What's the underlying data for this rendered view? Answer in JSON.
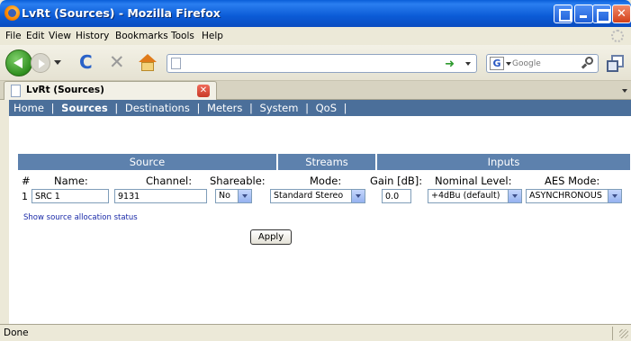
{
  "window": {
    "title": "LvRt (Sources) - Mozilla Firefox"
  },
  "menu": [
    "File",
    "Edit",
    "View",
    "History",
    "Bookmarks",
    "Tools",
    "Help"
  ],
  "toolbar": {
    "url": "",
    "search_placeholder": "Google"
  },
  "tab": {
    "label": "LvRt (Sources)"
  },
  "app_nav": {
    "items": [
      "Home",
      "Sources",
      "Destinations",
      "Meters",
      "System",
      "QoS"
    ],
    "active": "Sources"
  },
  "table": {
    "groups": [
      "Source",
      "Streams",
      "Inputs"
    ],
    "headers": {
      "num": "#",
      "name": "Name:",
      "channel": "Channel:",
      "shareable": "Shareable:",
      "mode": "Mode:",
      "gain": "Gain [dB]:",
      "nominal_level": "Nominal Level:",
      "aes_mode": "AES Mode:"
    },
    "rows": [
      {
        "num": "1",
        "name": "SRC 1",
        "channel": "9131",
        "shareable": "No",
        "mode": "Standard Stereo",
        "gain": "0.0",
        "nominal_level": "+4dBu (default)",
        "aes_mode": "ASYNCHRONOUS"
      }
    ]
  },
  "link_text": "Show source allocation status",
  "apply_label": "Apply",
  "status": {
    "text": "Done"
  }
}
